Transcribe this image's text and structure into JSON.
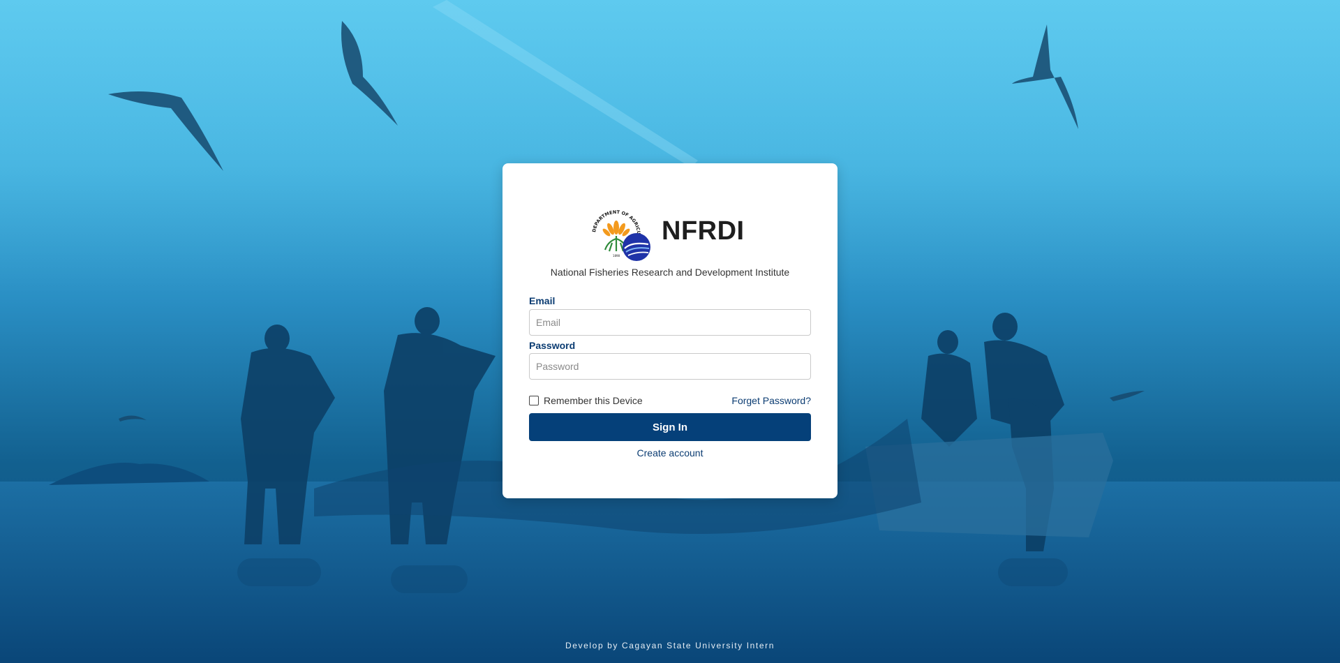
{
  "brand": {
    "name": "NFRDI",
    "subtitle": "National Fisheries Research and Development Institute",
    "logo_text": "DEPARTMENT OF AGRICULTURE",
    "logo_year": "1898"
  },
  "form": {
    "email_label": "Email",
    "email_placeholder": "Email",
    "email_value": "",
    "password_label": "Password",
    "password_placeholder": "Password",
    "password_value": "",
    "remember_label": "Remember this Device",
    "remember_checked": false,
    "forget_label": "Forget Password?",
    "signin_label": "Sign In",
    "create_label": "Create account"
  },
  "footer": {
    "text": "Develop by Cagayan State University Intern"
  },
  "colors": {
    "primary": "#054079",
    "label": "#0b3c72",
    "background_top": "#4cc3ec",
    "background_bottom": "#0a4e80"
  }
}
